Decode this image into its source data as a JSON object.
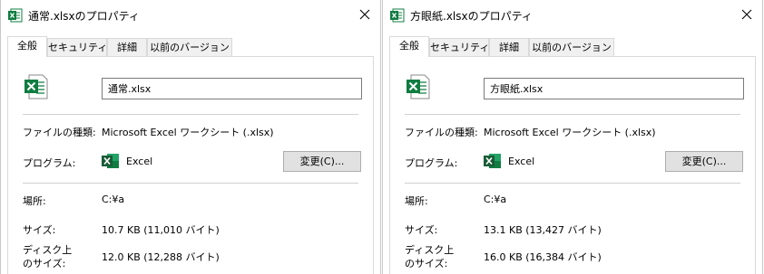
{
  "dialogs": [
    {
      "title": "通常.xlsxのプロパティ",
      "tabs": [
        "全般",
        "セキュリティ",
        "詳細",
        "以前のバージョン"
      ],
      "file_name": "通常.xlsx",
      "labels": {
        "file_type": "ファイルの種類:",
        "program": "プログラム:",
        "location": "場所:",
        "size": "サイズ:",
        "disk_size": "ディスク上\nのサイズ:"
      },
      "file_type": "Microsoft Excel ワークシート (.xlsx)",
      "program": "Excel",
      "change_button": "変更(C)...",
      "location": "C:¥a",
      "size": "10.7 KB (11,010 バイト)",
      "disk_size": "12.0 KB (12,288 バイト)"
    },
    {
      "title": "方眼紙.xlsxのプロパティ",
      "tabs": [
        "全般",
        "セキュリティ",
        "詳細",
        "以前のバージョン"
      ],
      "file_name": "方眼紙.xlsx",
      "labels": {
        "file_type": "ファイルの種類:",
        "program": "プログラム:",
        "location": "場所:",
        "size": "サイズ:",
        "disk_size": "ディスク上\nのサイズ:"
      },
      "file_type": "Microsoft Excel ワークシート (.xlsx)",
      "program": "Excel",
      "change_button": "変更(C)...",
      "location": "C:¥a",
      "size": "13.1 KB (13,427 バイト)",
      "disk_size": "16.0 KB (16,384 バイト)"
    }
  ],
  "colors": {
    "excel_green": "#107c41",
    "excel_dark": "#185c37"
  },
  "icons": {
    "title": "excel-file-icon",
    "close": "close-icon",
    "file": "excel-file-icon",
    "program": "excel-app-icon"
  }
}
